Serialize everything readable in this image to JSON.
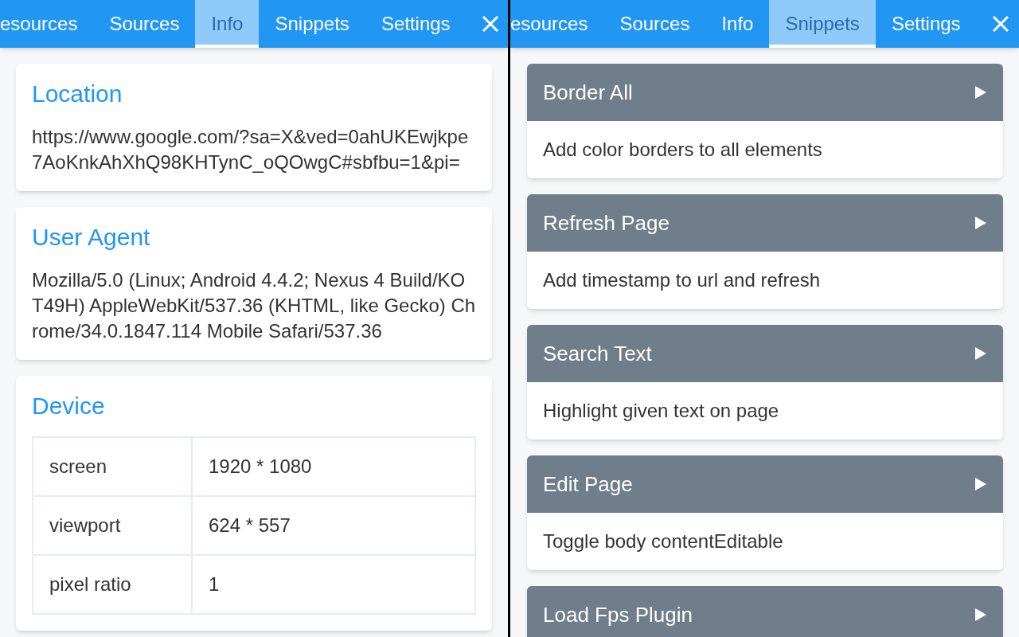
{
  "panels": [
    {
      "kind": "info",
      "tabs": [
        {
          "label": "esources",
          "selected": false
        },
        {
          "label": "Sources",
          "selected": false
        },
        {
          "label": "Info",
          "selected": true
        },
        {
          "label": "Snippets",
          "selected": false
        },
        {
          "label": "Settings",
          "selected": false
        }
      ],
      "sections": [
        {
          "kind": "text",
          "title": "Location",
          "text": "https://www.google.com/?sa=X&ved=0ahUKEwjkpe7AoKnkAhXhQ98KHTynC_oQOwgC#sbfbu=1&pi="
        },
        {
          "kind": "text",
          "title": "User Agent",
          "text": "Mozilla/5.0 (Linux; Android 4.4.2; Nexus 4 Build/KOT49H) AppleWebKit/537.36 (KHTML, like Gecko) Chrome/34.0.1847.114 Mobile Safari/537.36"
        },
        {
          "kind": "table",
          "title": "Device",
          "rows": [
            {
              "key": "screen",
              "value": "1920 * 1080"
            },
            {
              "key": "viewport",
              "value": "624 * 557"
            },
            {
              "key": "pixel ratio",
              "value": "1"
            }
          ]
        }
      ]
    },
    {
      "kind": "snippets",
      "tabs": [
        {
          "label": "esources",
          "selected": false
        },
        {
          "label": "Sources",
          "selected": false
        },
        {
          "label": "Info",
          "selected": false
        },
        {
          "label": "Snippets",
          "selected": true
        },
        {
          "label": "Settings",
          "selected": false
        }
      ],
      "snippets": [
        {
          "name": "Border All",
          "description": "Add color borders to all elements"
        },
        {
          "name": "Refresh Page",
          "description": "Add timestamp to url and refresh"
        },
        {
          "name": "Search Text",
          "description": "Highlight given text on page"
        },
        {
          "name": "Edit Page",
          "description": "Toggle body contentEditable"
        },
        {
          "name": "Load Fps Plugin"
        }
      ]
    }
  ]
}
